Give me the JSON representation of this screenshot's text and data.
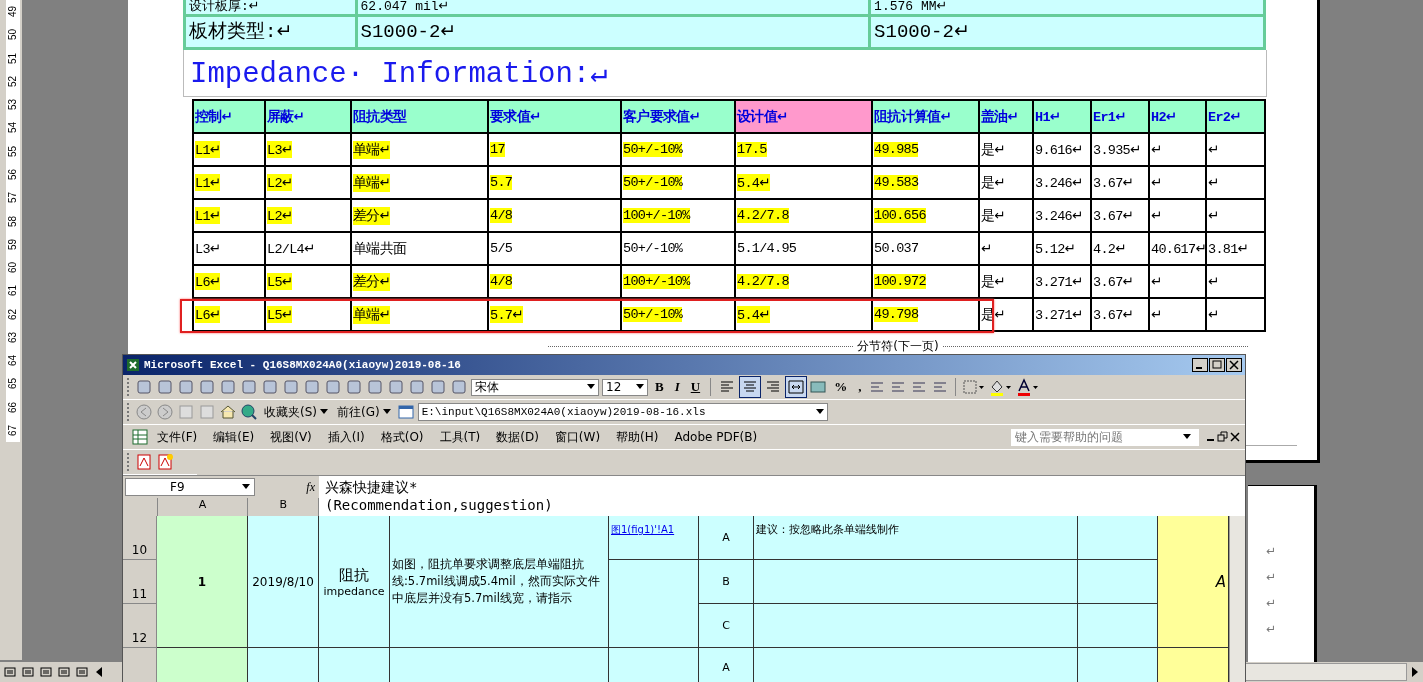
{
  "ruler": {
    "numbers": [
      "49",
      "50",
      "51",
      "52",
      "53",
      "54",
      "55",
      "56",
      "57",
      "58",
      "59",
      "60",
      "61",
      "62",
      "63",
      "64",
      "65",
      "66",
      "67"
    ]
  },
  "document": {
    "spec_rows": [
      {
        "label": "设计板厚:↵",
        "value1": "62.047 mil↵",
        "value2": "1.576 MM↵"
      },
      {
        "label": "板材类型:↵",
        "value1": "S1000-2↵",
        "value2": "S1000-2↵"
      }
    ],
    "heading": "Impedance· Information:↵",
    "impedance_table": {
      "columns": [
        {
          "label": "控制↵",
          "color": "#99ffcc"
        },
        {
          "label": "屏蔽↵",
          "color": "#99ffcc"
        },
        {
          "label": "阻抗类型",
          "color": "#99ffcc"
        },
        {
          "label": "要求值↵",
          "color": "#99ffcc"
        },
        {
          "label": "客户要求值↵",
          "color": "#99ffcc"
        },
        {
          "label": "设计值↵",
          "color": "#ff99cc"
        },
        {
          "label": "阻抗计算值↵",
          "color": "#99ffcc"
        },
        {
          "label": "盖油↵",
          "color": "#99ffcc"
        },
        {
          "label": "H1↵",
          "color": "#99ffcc"
        },
        {
          "label": "Er1↵",
          "color": "#99ffcc"
        },
        {
          "label": "H2↵",
          "color": "#99ffcc"
        },
        {
          "label": "Er2↵",
          "color": "#99ffcc"
        }
      ],
      "rows": [
        {
          "highlighted": true,
          "outlined": false,
          "cells": [
            "L1↵",
            "L3↵",
            "单端↵",
            "17",
            "50+/-10%",
            "17.5",
            "49.985",
            "是↵",
            "9.616↵",
            "3.935↵",
            "↵",
            "↵"
          ]
        },
        {
          "highlighted": true,
          "outlined": false,
          "cells": [
            "L1↵",
            "L2↵",
            "单端↵",
            "5.7",
            "50+/-10%",
            "5.4↵",
            "49.583",
            "是↵",
            "3.246↵",
            "3.67↵",
            "↵",
            "↵"
          ]
        },
        {
          "highlighted": true,
          "outlined": false,
          "cells": [
            "L1↵",
            "L2↵",
            "差分↵",
            "4/8",
            "100+/-10%",
            "4.2/7.8",
            "100.656",
            "是↵",
            "3.246↵",
            "3.67↵",
            "↵",
            "↵"
          ]
        },
        {
          "highlighted": false,
          "outlined": false,
          "cells": [
            "L3↵",
            "L2/L4↵",
            "单端共面",
            "5/5",
            "50+/-10%",
            "5.1/4.95",
            "50.037",
            "↵",
            "5.12↵",
            "4.2↵",
            "40.617↵",
            "3.81↵"
          ]
        },
        {
          "highlighted": true,
          "outlined": false,
          "cells": [
            "L6↵",
            "L5↵",
            "差分↵",
            "4/8",
            "100+/-10%",
            "4.2/7.8",
            "100.972",
            "是↵",
            "3.271↵",
            "3.67↵",
            "↵",
            "↵"
          ]
        },
        {
          "highlighted": true,
          "outlined": true,
          "cells": [
            "L6↵",
            "L5↵",
            "单端↵",
            "5.7↵",
            "50+/-10%",
            "5.4↵",
            "49.798",
            "是↵",
            "3.271↵",
            "3.67↵",
            "↵",
            "↵"
          ]
        }
      ]
    },
    "section_break": "分节符(下一页)",
    "next_page_marks": [
      "↵",
      "↵",
      "↵",
      "↵"
    ]
  },
  "excel": {
    "title": "Microsoft Excel - Q16S8MX024A0(xiaoyw)2019-08-16",
    "font": "宋体",
    "font_size": "12",
    "format_buttons": [
      "B",
      "I",
      "U"
    ],
    "align_buttons": [
      {
        "kind": "left",
        "selected": false
      },
      {
        "kind": "center",
        "selected": true
      },
      {
        "kind": "right",
        "selected": false
      },
      {
        "kind": "merge",
        "selected": true
      }
    ],
    "number_buttons": [
      "%",
      ","
    ],
    "favorites": "收藏夹(S)",
    "go": "前往(G)",
    "address": "E:\\input\\Q16S8MX024A0(xiaoyw)2019-08-16.xls",
    "menus": [
      "文件(F)",
      "编辑(E)",
      "视图(V)",
      "插入(I)",
      "格式(O)",
      "工具(T)",
      "数据(D)",
      "窗口(W)",
      "帮助(H)",
      "Adobe PDF(B)"
    ],
    "help_placeholder": "键入需要帮助的问题",
    "name_box": "F9",
    "fx": "fx",
    "formula_lines": [
      "兴森快捷建议*",
      "(Recommendation,suggestion)"
    ],
    "columns": [
      "A",
      "B"
    ],
    "row_numbers": [
      "10",
      "11",
      "12"
    ],
    "entry": {
      "number": "1",
      "date": "2019/8/10",
      "category": "阻抗",
      "category_en": "impedance",
      "description": "如图，阻抗单要求调整底层单端阻抗线:5.7mil线调成5.4mil，然而实际文件中底层并没有5.7mil线宽，请指示",
      "link": "图1(fig1)'!A1",
      "options": [
        {
          "label": "A",
          "reply": "建议：按忽略此条单端线制作"
        },
        {
          "label": "B"
        },
        {
          "label": "C"
        }
      ],
      "status": "A"
    },
    "next_entry_option": "A"
  }
}
